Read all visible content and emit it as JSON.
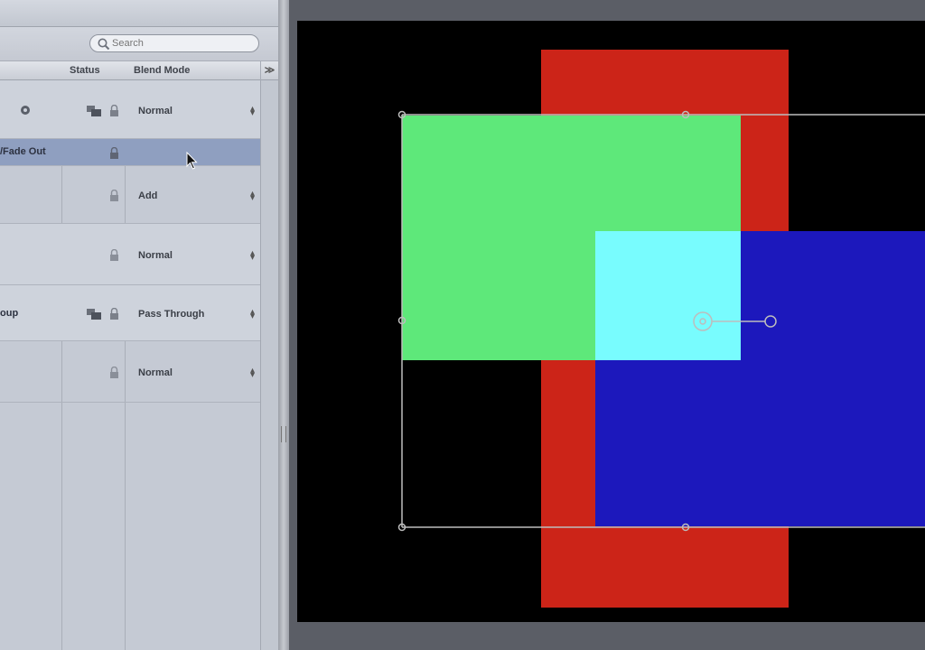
{
  "layers_panel": {
    "search": {
      "placeholder": "Search"
    },
    "columns": {
      "status": "Status",
      "blend_mode": "Blend Mode",
      "more": "≫"
    },
    "rows": [
      {
        "name": "",
        "status_icons": [
          "group",
          "lock"
        ],
        "blend_mode": "Normal",
        "has_stepper": true,
        "selected": false
      },
      {
        "name": "/Fade Out",
        "status_icons": [
          "lock"
        ],
        "blend_mode": "",
        "has_stepper": false,
        "selected": true
      },
      {
        "name": "",
        "status_icons": [
          "lock"
        ],
        "blend_mode": "Add",
        "has_stepper": true,
        "selected": false
      },
      {
        "name": "",
        "status_icons": [
          "lock"
        ],
        "blend_mode": "Normal",
        "has_stepper": true,
        "selected": false
      },
      {
        "name": "oup",
        "status_icons": [
          "group",
          "lock"
        ],
        "blend_mode": "Pass Through",
        "has_stepper": true,
        "selected": false
      },
      {
        "name": "",
        "status_icons": [
          "lock"
        ],
        "blend_mode": "Normal",
        "has_stepper": true,
        "selected": false
      }
    ]
  },
  "canvas": {
    "background": "#000000",
    "shapes": [
      {
        "name": "red-rectangle",
        "color": "#cc2418"
      },
      {
        "name": "green-rectangle",
        "color": "#5ee87a"
      },
      {
        "name": "blue-rectangle",
        "color": "#1c18bc"
      },
      {
        "name": "cyan-overlap",
        "color": "#78fcfe"
      }
    ],
    "selection_color": "#bdbdbd"
  },
  "icons": {
    "search": "magnifier-icon",
    "lock": "lock-icon",
    "group": "group-icon",
    "gear": "gear-icon",
    "cursor": "mouse-pointer-icon",
    "anchor": "anchor-point-icon"
  }
}
